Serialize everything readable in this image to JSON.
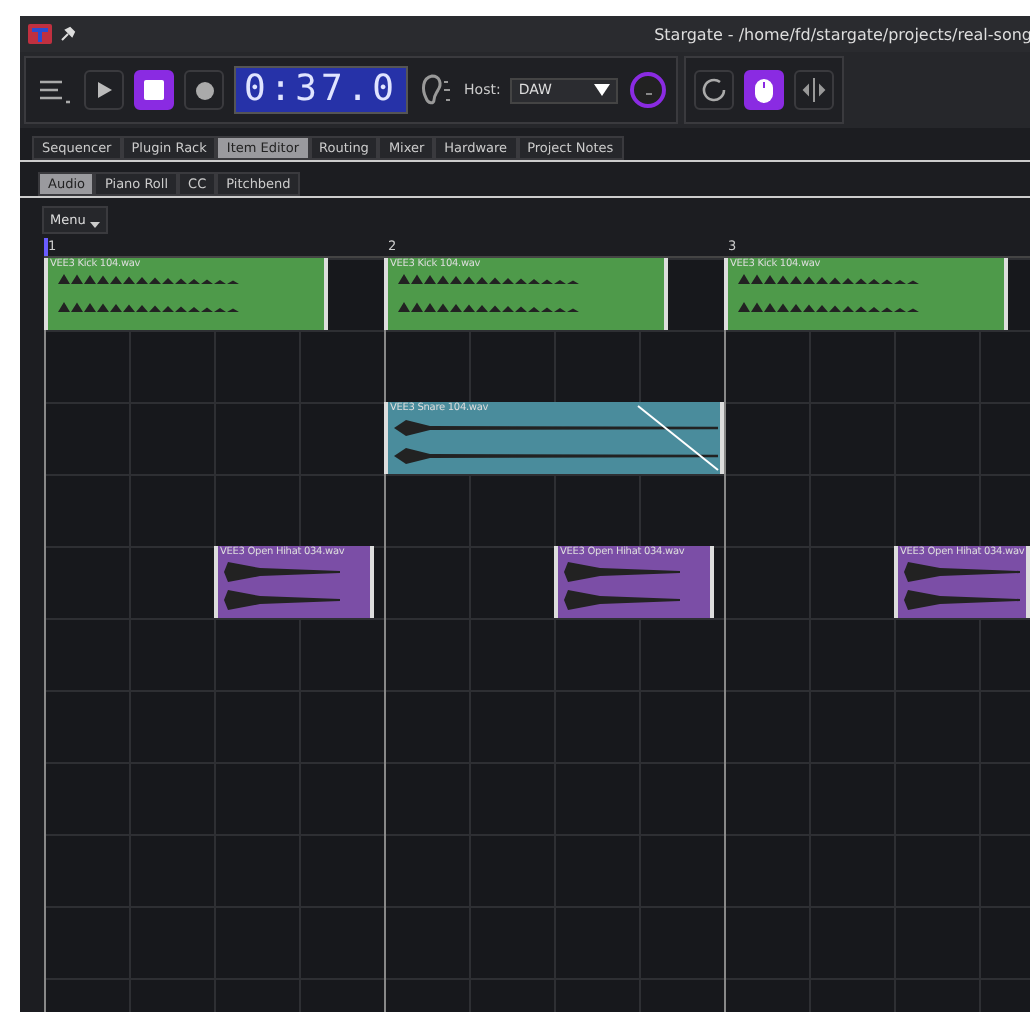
{
  "window": {
    "title": "Stargate - /home/fd/stargate/projects/real-song"
  },
  "transport": {
    "time": "0:37.0",
    "host_label": "Host:",
    "host_value": "DAW",
    "playing": false
  },
  "main_tabs": [
    {
      "label": "Sequencer",
      "selected": false
    },
    {
      "label": "Plugin Rack",
      "selected": false
    },
    {
      "label": "Item Editor",
      "selected": true
    },
    {
      "label": "Routing",
      "selected": false
    },
    {
      "label": "Mixer",
      "selected": false
    },
    {
      "label": "Hardware",
      "selected": false
    },
    {
      "label": "Project Notes",
      "selected": false
    }
  ],
  "sub_tabs": [
    {
      "label": "Audio",
      "selected": true
    },
    {
      "label": "Piano Roll",
      "selected": false
    },
    {
      "label": "CC",
      "selected": false
    },
    {
      "label": "Pitchbend",
      "selected": false
    }
  ],
  "menu_button": "Menu",
  "ruler": [
    "1",
    "2",
    "3"
  ],
  "clips": [
    {
      "name": "VEE3 Kick 104.wav",
      "color": "#4e9a4a",
      "kind": "kick"
    },
    {
      "name": "VEE3 Kick 104.wav",
      "color": "#4e9a4a",
      "kind": "kick"
    },
    {
      "name": "VEE3 Kick 104.wav",
      "color": "#4e9a4a",
      "kind": "kick"
    },
    {
      "name": "VEE3 Snare 104.wav",
      "color": "#4a8c9c",
      "kind": "snare"
    },
    {
      "name": "VEE3 Open Hihat 034.wav",
      "color": "#7b4ea6",
      "kind": "hihat"
    },
    {
      "name": "VEE3 Open Hihat 034.wav",
      "color": "#7b4ea6",
      "kind": "hihat"
    },
    {
      "name": "VEE3 Open Hihat 034.wav",
      "color": "#7b4ea6",
      "kind": "hihat"
    }
  ]
}
